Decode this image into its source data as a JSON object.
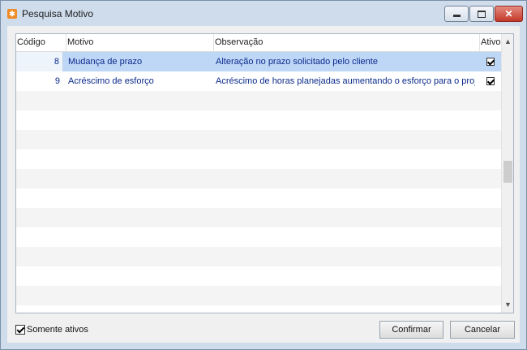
{
  "window": {
    "title": "Pesquisa Motivo",
    "icon": "app-logo-icon"
  },
  "grid": {
    "columns": {
      "codigo": "Código",
      "motivo": "Motivo",
      "observacao": "Observação",
      "ativo": "Ativo"
    },
    "rows": [
      {
        "codigo": "8",
        "motivo": "Mudança de prazo",
        "observacao": "Alteração no prazo solicitado pelo cliente",
        "ativo": true,
        "selected": true
      },
      {
        "codigo": "9",
        "motivo": "Acréscimo de esforço",
        "observacao": "Acréscimo de horas planejadas aumentando o esforço para o projeto",
        "ativo": true,
        "selected": false
      }
    ]
  },
  "filter": {
    "label": "Somente ativos",
    "checked": true
  },
  "buttons": {
    "confirm": "Confirmar",
    "cancel": "Cancelar"
  },
  "colors": {
    "selection": "#bfd7f7",
    "link_text": "#0a2a8a"
  }
}
